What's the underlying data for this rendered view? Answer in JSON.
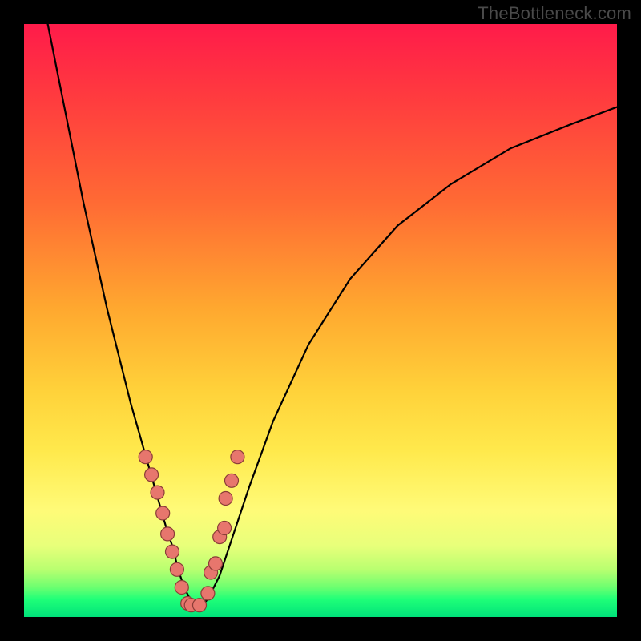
{
  "watermark": "TheBottleneck.com",
  "colors": {
    "dot_fill": "#e7766d",
    "dot_stroke": "#8a3d37",
    "curve": "#000000"
  },
  "chart_data": {
    "type": "line",
    "title": "",
    "xlabel": "",
    "ylabel": "",
    "xlim": [
      0,
      100
    ],
    "ylim": [
      0,
      100
    ],
    "grid": false,
    "note": "No axis ticks or numeric labels are rendered; values are pixel-fraction estimates (0=left/bottom, 100=right/top).",
    "series": [
      {
        "name": "curve",
        "x": [
          4,
          6,
          8,
          10,
          12,
          14,
          16,
          18,
          20,
          22,
          24,
          25,
          26,
          27,
          28,
          29,
          30,
          31,
          33,
          35,
          38,
          42,
          48,
          55,
          63,
          72,
          82,
          92,
          100
        ],
        "y": [
          100,
          90,
          80,
          70,
          61,
          52,
          44,
          36,
          29,
          22,
          15,
          12,
          8,
          5,
          3,
          2,
          2,
          3,
          7,
          13,
          22,
          33,
          46,
          57,
          66,
          73,
          79,
          83,
          86
        ]
      }
    ],
    "highlight_points": {
      "name": "dots",
      "comment": "Pink dots along the valley of the curve",
      "x": [
        20.5,
        21.5,
        22.5,
        23.4,
        24.2,
        25.0,
        25.8,
        26.6,
        27.6,
        28.2,
        29.6,
        31.0,
        31.5,
        32.3,
        33.0,
        33.8,
        34.0,
        35.0,
        36.0
      ],
      "y": [
        27.0,
        24.0,
        21.0,
        17.5,
        14.0,
        11.0,
        8.0,
        5.0,
        2.3,
        2.0,
        2.0,
        4.0,
        7.5,
        9.0,
        13.5,
        15.0,
        20.0,
        23.0,
        27.0
      ]
    }
  }
}
